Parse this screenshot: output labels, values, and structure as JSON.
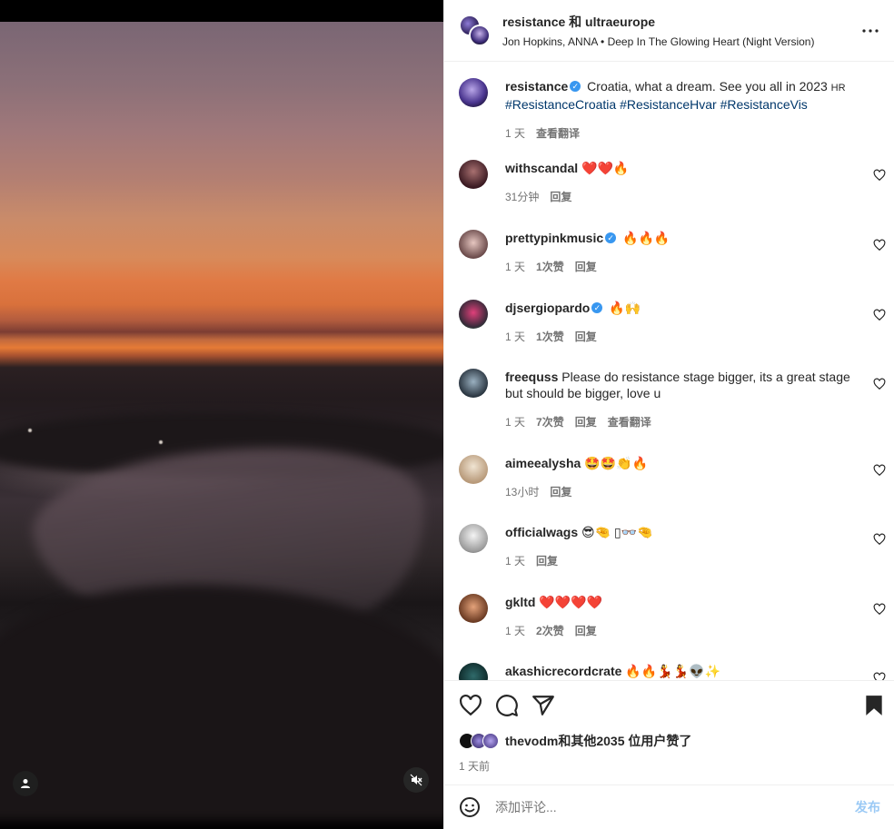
{
  "header": {
    "names": "resistance 和 ultraeurope",
    "music": "Jon Hopkins, ANNA • Deep In The Glowing Heart (Night Version)"
  },
  "caption": {
    "username": "resistance",
    "text": "Croatia, what a dream. See you all in 2023 ",
    "flag": "HR",
    "hashtags": [
      "#ResistanceCroatia",
      "#ResistanceHvar",
      "#ResistanceVis"
    ],
    "time": "1 天",
    "translate": "查看翻译"
  },
  "comments": [
    {
      "username": "withscandal",
      "verified": false,
      "text": "❤️❤️🔥",
      "time": "31分钟",
      "likes": "",
      "reply": "回复"
    },
    {
      "username": "prettypinkmusic",
      "verified": true,
      "text": "🔥🔥🔥",
      "time": "1 天",
      "likes": "1次赞",
      "reply": "回复"
    },
    {
      "username": "djsergiopardo",
      "verified": true,
      "text": "🔥🙌",
      "time": "1 天",
      "likes": "1次赞",
      "reply": "回复"
    },
    {
      "username": "freequss",
      "verified": false,
      "text": "Please do resistance stage bigger, its a great stage but should be bigger, love u",
      "time": "1 天",
      "likes": "7次赞",
      "reply": "回复",
      "translate": "查看翻译"
    },
    {
      "username": "aimeealysha",
      "verified": false,
      "text": "🤩🤩👏🔥",
      "time": "13小时",
      "likes": "",
      "reply": "回复"
    },
    {
      "username": "officialwags",
      "verified": false,
      "text": "😎🤏 ▯👓🤏",
      "time": "1 天",
      "likes": "",
      "reply": "回复"
    },
    {
      "username": "gkltd",
      "verified": false,
      "text": "❤️❤️❤️❤️",
      "time": "1 天",
      "likes": "2次赞",
      "reply": "回复"
    },
    {
      "username": "akashicrecordcrate",
      "verified": false,
      "text": "🔥🔥💃💃👽✨",
      "time": "",
      "likes": "",
      "reply": ""
    }
  ],
  "likes_summary": "thevodm和其他2035 位用户赞了",
  "post_date": "1 天前",
  "composer": {
    "placeholder": "添加评论...",
    "post_label": "发布"
  },
  "icons": {
    "more": "more-icon",
    "heart": "heart-icon",
    "comment": "comment-icon",
    "share": "share-icon",
    "save": "bookmark-icon",
    "emoji": "emoji-icon",
    "user_tag": "user-icon",
    "mute": "muted-icon"
  },
  "colors": {
    "verified": "#3897f0",
    "hashtag": "#00376b",
    "meta": "#737373",
    "post_button": "#9ac9f5"
  }
}
